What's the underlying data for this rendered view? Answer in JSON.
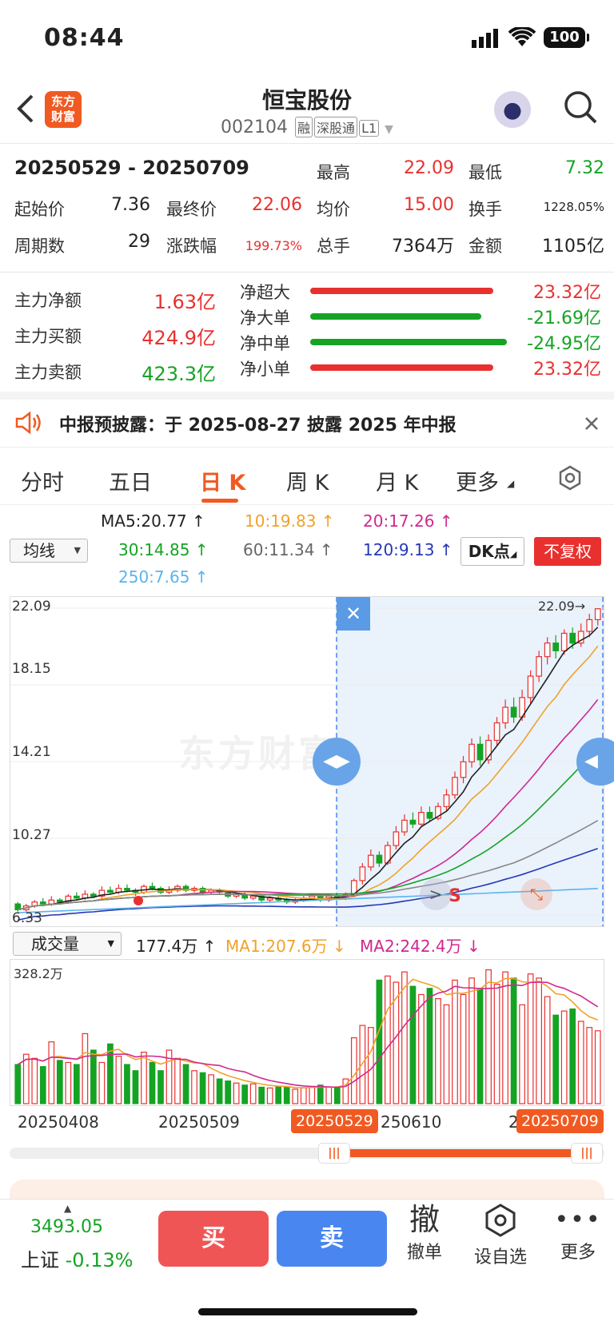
{
  "status": {
    "time": "08:44",
    "battery": "100"
  },
  "header": {
    "logo_line1": "东方",
    "logo_line2": "财富",
    "name": "恒宝股份",
    "code": "002104",
    "tags": [
      "融",
      "深股通",
      "L1"
    ]
  },
  "summary": {
    "range": "20250529  -  20250709",
    "high_label": "最高",
    "high": "22.09",
    "low_label": "最低",
    "low": "7.32",
    "start_label": "起始价",
    "start": "7.36",
    "end_label": "最终价",
    "end": "22.06",
    "avg_label": "均价",
    "avg": "15.00",
    "turnover_label": "换手",
    "turnover": "1228.05%",
    "periods_label": "周期数",
    "periods": "29",
    "change_label": "涨跌幅",
    "change": "199.73%",
    "volume_label": "总手",
    "volume": "7364万",
    "amount_label": "金额",
    "amount": "1105亿"
  },
  "funds": {
    "net_label": "主力净额",
    "net": "1.63亿",
    "buy_label": "主力买额",
    "buy": "424.9亿",
    "sell_label": "主力卖额",
    "sell": "423.3亿",
    "rows": [
      {
        "label": "净超大",
        "value": "23.32亿",
        "color": "#e8312f",
        "ratio": 0.93
      },
      {
        "label": "净大单",
        "value": "-21.69亿",
        "color": "#15a324",
        "ratio": 0.87
      },
      {
        "label": "净中单",
        "value": "-24.95亿",
        "color": "#15a324",
        "ratio": 1.0
      },
      {
        "label": "净小单",
        "value": "23.32亿",
        "color": "#e8312f",
        "ratio": 0.93
      }
    ]
  },
  "notice": {
    "text": "中报预披露：于 2025-08-27 披露 2025 年中报"
  },
  "tabs": [
    "分时",
    "五日",
    "日 K",
    "周 K",
    "月 K",
    "更多"
  ],
  "active_tab": 2,
  "ma": {
    "selector": "均线",
    "ma5": "MA5:20.77 ↑",
    "ma10": "10:19.83 ↑",
    "ma20": "20:17.26 ↑",
    "ma30": "30:14.85 ↑",
    "ma60": "60:11.34 ↑",
    "ma120": "120:9.13 ↑",
    "ma250": "250:7.65 ↑",
    "dk": "DK点",
    "fq": "不复权"
  },
  "kline": {
    "ticks": [
      "22.09",
      "18.15",
      "14.21",
      "10.27",
      "6.33"
    ],
    "last_label": "22.09→",
    "left_marker": "6.33",
    "s_marker": "S",
    "watermark": "东方财富"
  },
  "volume": {
    "selector": "成交量",
    "current": "177.4万 ↑",
    "ma1": "MA1:207.6万 ↓",
    "ma2": "MA2:242.4万 ↓",
    "max": "328.2万",
    "dates": [
      "20250408",
      "20250509",
      "250610",
      "2"
    ],
    "range_start": "20250529",
    "range_end": "20250709"
  },
  "chart_data": {
    "type": "candlestick",
    "ylim": [
      6.33,
      22.09
    ],
    "ticks": [
      22.09,
      18.15,
      14.21,
      10.27,
      6.33
    ],
    "candles": [
      [
        6.9,
        6.6,
        7.0,
        6.5
      ],
      [
        6.6,
        6.8,
        6.9,
        6.5
      ],
      [
        6.8,
        7.0,
        7.1,
        6.7
      ],
      [
        7.0,
        6.9,
        7.2,
        6.8
      ],
      [
        6.9,
        7.1,
        7.3,
        6.8
      ],
      [
        7.1,
        7.0,
        7.2,
        6.9
      ],
      [
        7.0,
        7.3,
        7.4,
        6.9
      ],
      [
        7.3,
        7.2,
        7.5,
        7.1
      ],
      [
        7.2,
        7.4,
        7.6,
        7.1
      ],
      [
        7.4,
        7.3,
        7.5,
        7.2
      ],
      [
        7.3,
        7.6,
        7.8,
        7.2
      ],
      [
        7.6,
        7.5,
        7.8,
        7.4
      ],
      [
        7.5,
        7.7,
        7.9,
        7.4
      ],
      [
        7.7,
        7.6,
        7.9,
        7.5
      ],
      [
        7.6,
        7.5,
        7.7,
        7.3
      ],
      [
        7.5,
        7.8,
        7.9,
        7.4
      ],
      [
        7.8,
        7.7,
        8.0,
        7.6
      ],
      [
        7.7,
        7.5,
        7.8,
        7.4
      ],
      [
        7.5,
        7.6,
        7.8,
        7.4
      ],
      [
        7.6,
        7.8,
        7.9,
        7.5
      ],
      [
        7.8,
        7.6,
        7.9,
        7.5
      ],
      [
        7.6,
        7.7,
        7.8,
        7.5
      ],
      [
        7.7,
        7.5,
        7.8,
        7.4
      ],
      [
        7.5,
        7.6,
        7.7,
        7.4
      ],
      [
        7.6,
        7.5,
        7.7,
        7.4
      ],
      [
        7.5,
        7.3,
        7.6,
        7.2
      ],
      [
        7.3,
        7.4,
        7.5,
        7.2
      ],
      [
        7.4,
        7.2,
        7.5,
        7.1
      ],
      [
        7.2,
        7.3,
        7.4,
        7.1
      ],
      [
        7.3,
        7.1,
        7.4,
        7.0
      ],
      [
        7.1,
        7.2,
        7.3,
        7.0
      ],
      [
        7.2,
        7.1,
        7.3,
        7.0
      ],
      [
        7.1,
        7.0,
        7.2,
        6.9
      ],
      [
        7.0,
        7.1,
        7.2,
        6.9
      ],
      [
        7.1,
        7.2,
        7.3,
        7.0
      ],
      [
        7.2,
        7.3,
        7.4,
        7.1
      ],
      [
        7.3,
        7.1,
        7.4,
        7.0
      ],
      [
        7.1,
        7.3,
        7.4,
        7.0
      ],
      [
        7.3,
        7.2,
        7.4,
        7.1
      ],
      [
        7.2,
        7.36,
        7.5,
        7.1
      ],
      [
        7.36,
        8.1,
        8.2,
        7.32
      ],
      [
        8.1,
        8.8,
        9.0,
        7.9
      ],
      [
        8.8,
        9.4,
        9.7,
        8.6
      ],
      [
        9.4,
        9.0,
        9.6,
        8.8
      ],
      [
        9.0,
        9.9,
        10.1,
        8.9
      ],
      [
        9.9,
        10.6,
        10.9,
        9.7
      ],
      [
        10.6,
        11.2,
        11.5,
        10.4
      ],
      [
        11.2,
        11.0,
        11.6,
        10.8
      ],
      [
        11.0,
        11.6,
        11.9,
        10.9
      ],
      [
        11.6,
        11.3,
        11.9,
        11.1
      ],
      [
        11.3,
        11.9,
        12.1,
        11.2
      ],
      [
        11.9,
        12.5,
        12.8,
        11.7
      ],
      [
        12.5,
        13.4,
        13.7,
        12.3
      ],
      [
        13.4,
        14.2,
        14.5,
        13.1
      ],
      [
        14.2,
        15.1,
        15.4,
        13.9
      ],
      [
        15.1,
        14.3,
        15.5,
        14.0
      ],
      [
        14.3,
        15.3,
        15.6,
        14.1
      ],
      [
        15.3,
        16.2,
        16.5,
        15.0
      ],
      [
        16.2,
        17.0,
        17.4,
        15.9
      ],
      [
        17.0,
        16.5,
        17.5,
        16.2
      ],
      [
        16.5,
        17.5,
        17.9,
        16.3
      ],
      [
        17.5,
        18.6,
        18.9,
        17.2
      ],
      [
        18.6,
        19.6,
        19.9,
        18.3
      ],
      [
        19.6,
        20.3,
        20.6,
        19.2
      ],
      [
        20.3,
        19.9,
        20.7,
        19.5
      ],
      [
        19.9,
        20.8,
        21.0,
        19.7
      ],
      [
        20.8,
        20.3,
        21.1,
        20.0
      ],
      [
        20.3,
        20.9,
        21.3,
        20.1
      ],
      [
        20.9,
        21.5,
        21.8,
        20.6
      ],
      [
        21.5,
        22.06,
        22.09,
        21.2
      ]
    ],
    "volumes": [
      95,
      120,
      110,
      90,
      150,
      105,
      100,
      95,
      170,
      130,
      100,
      145,
      115,
      95,
      80,
      125,
      100,
      80,
      130,
      110,
      95,
      80,
      75,
      70,
      60,
      55,
      50,
      45,
      48,
      40,
      38,
      42,
      40,
      35,
      38,
      42,
      45,
      40,
      38,
      60,
      160,
      190,
      185,
      300,
      310,
      295,
      320,
      285,
      265,
      280,
      255,
      240,
      300,
      265,
      305,
      280,
      325,
      290,
      320,
      305,
      240,
      315,
      305,
      260,
      215,
      225,
      230,
      200,
      185,
      177
    ]
  }
}
